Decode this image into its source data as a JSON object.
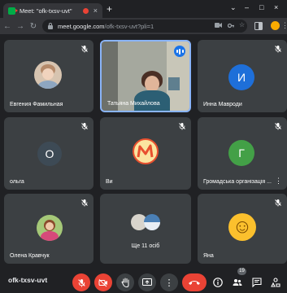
{
  "browser": {
    "tab_title": "Meet: \"ofk-txsv-uvt\"",
    "tab_close": "×",
    "new_tab": "+",
    "url_host": "meet.google.com",
    "url_path": "/ofk-txsv-uvt?pli=1",
    "window_controls": [
      "⌄",
      "–",
      "□",
      "×"
    ]
  },
  "tiles": [
    {
      "name": "Евгения Фамильная",
      "avatar_type": "photo",
      "avatar_color": "#c9a88a",
      "muted": true
    },
    {
      "name": "Татьяна Михайлова",
      "avatar_type": "video",
      "muted": false,
      "speaking": true
    },
    {
      "name": "Инна Мавроди",
      "avatar_type": "letter",
      "letter": "И",
      "avatar_color": "#1e6fd9",
      "muted": true
    },
    {
      "name": "ольга",
      "avatar_type": "letter",
      "letter": "О",
      "avatar_color": "#3d4a55",
      "muted": true
    },
    {
      "name": "Ви",
      "avatar_type": "photo",
      "avatar_color": "#e8502f",
      "muted": true
    },
    {
      "name": "Громадська організація ...",
      "avatar_type": "letter",
      "letter": "Г",
      "avatar_color": "#43a047",
      "muted": true
    },
    {
      "name": "Олена Кравчук",
      "avatar_type": "photo",
      "avatar_color": "#8bc34a",
      "muted": true
    },
    {
      "name": "Ще 11 осіб",
      "avatar_type": "group",
      "muted": false
    },
    {
      "name": "Яна",
      "avatar_type": "emoji",
      "letter": "☺",
      "avatar_color": "#fbc02d",
      "muted": true
    }
  ],
  "bottombar": {
    "meeting_code": "ofk-txsv-uvt",
    "participant_count": "19"
  },
  "colors": {
    "background": "#202124",
    "tile": "#3c4043",
    "accent": "#8ab4f8",
    "danger": "#ea4335"
  }
}
